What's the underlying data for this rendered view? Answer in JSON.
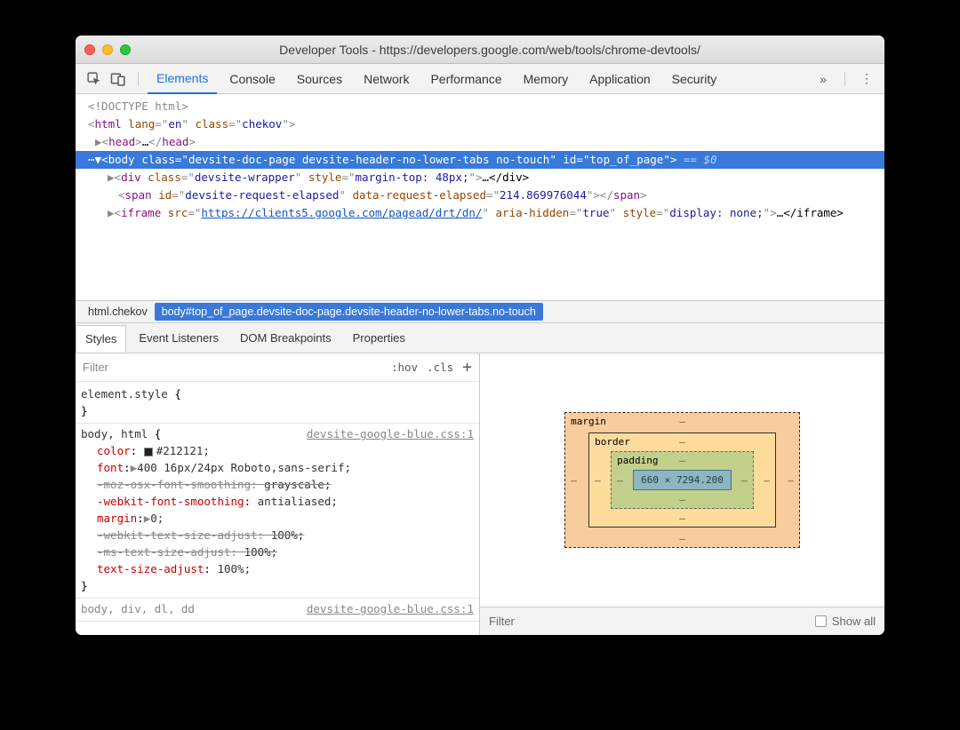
{
  "window": {
    "title": "Developer Tools - https://developers.google.com/web/tools/chrome-devtools/"
  },
  "toolbar": {
    "tabs": [
      "Elements",
      "Console",
      "Sources",
      "Network",
      "Performance",
      "Memory",
      "Application",
      "Security"
    ],
    "overflow": "»",
    "more": "⋮"
  },
  "dom": {
    "l1": "<!DOCTYPE html>",
    "l2": {
      "tag": "html",
      "attrs": [
        [
          "lang",
          "en"
        ],
        [
          "class",
          "chekov"
        ]
      ]
    },
    "l3": {
      "tag": "head",
      "text": "…"
    },
    "sel": {
      "ellipsis": "⋯",
      "tag": "body",
      "attrs": [
        [
          "class",
          "devsite-doc-page devsite-header-no-lower-tabs no-touch"
        ],
        [
          "id",
          "top_of_page"
        ]
      ],
      "hint": " == $0"
    },
    "l5": {
      "tag": "div",
      "attrs": [
        [
          "class",
          "devsite-wrapper"
        ],
        [
          "style",
          "margin-top: 48px;"
        ]
      ],
      "tail": "…</div>"
    },
    "l6": {
      "tag": "span",
      "attrs": [
        [
          "id",
          "devsite-request-elapsed"
        ],
        [
          "data-request-elapsed",
          "214.869976044"
        ]
      ]
    },
    "l7": {
      "tag": "iframe",
      "attrs": [
        [
          "src",
          "https://clients5.google.com/pagead/drt/dn/"
        ],
        [
          "aria-hidden",
          "true"
        ],
        [
          "style",
          "display: none;"
        ]
      ],
      "tail": "…</iframe>"
    }
  },
  "crumbs": {
    "c1": "html.chekov",
    "c2": "body#top_of_page.devsite-doc-page.devsite-header-no-lower-tabs.no-touch"
  },
  "subtabs": [
    "Styles",
    "Event Listeners",
    "DOM Breakpoints",
    "Properties"
  ],
  "styles": {
    "filter": "Filter",
    "hov": ":hov",
    "cls": ".cls",
    "plus": "+",
    "elstyle": {
      "sel": "element.style",
      "open": "{",
      "close": "}"
    },
    "rule1": {
      "sel": "body, html",
      "src": "devsite-google-blue.css:1",
      "decls": [
        {
          "p": "color",
          "swatch": "#212121",
          "v": "#212121;"
        },
        {
          "p": "font",
          "tri": "▶",
          "v": "400 16px/24px Roboto,sans-serif;"
        },
        {
          "p": "-moz-osx-font-smoothing",
          "v": "grayscale;",
          "strike": true
        },
        {
          "p": "-webkit-font-smoothing",
          "v": "antialiased;"
        },
        {
          "p": "margin",
          "tri": "▶",
          "v": "0;"
        },
        {
          "p": "-webkit-text-size-adjust",
          "v": "100%;",
          "strike": true
        },
        {
          "p": "-ms-text-size-adjust",
          "v": "100%;",
          "strike": true
        },
        {
          "p": "text-size-adjust",
          "v": "100%;"
        }
      ]
    },
    "rule2": {
      "sel": "body, div, dl, dd",
      "src": "devsite-google-blue.css:1"
    }
  },
  "boxmodel": {
    "margin": "margin",
    "border": "border",
    "padding": "padding",
    "dash": "–",
    "content": "660 × 7294.200"
  },
  "cfilter": {
    "label": "Filter",
    "showall": "Show all"
  }
}
